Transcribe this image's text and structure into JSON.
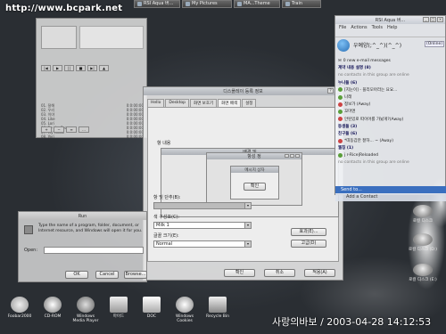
{
  "watermark": "http://www.bcpark.net",
  "taskbar": [
    {
      "label": "RSI Aqua 버..."
    },
    {
      "label": "My Pictures"
    },
    {
      "label": "MA...Theme"
    },
    {
      "label": "Train"
    }
  ],
  "player": {
    "playlist": [
      {
        "name": "01. 잘해",
        "time": "0:0:00:00"
      },
      {
        "name": "02. 우리",
        "time": "0:0:00:00"
      },
      {
        "name": "03. 이야",
        "time": "0:0:00:00"
      },
      {
        "name": "04. Like",
        "time": "0:0:00:00"
      },
      {
        "name": "05. Lori",
        "time": "0:0:00:00"
      },
      {
        "name": "06. By the Sea",
        "time": "0:0:00:00"
      },
      {
        "name": "07. My Music",
        "time": "0:0:00:00"
      },
      {
        "name": "08. Yeri",
        "time": "0:0:00:00"
      }
    ]
  },
  "display_props": {
    "title": "디스플레이 등록 정보",
    "tabs": [
      "Hello",
      "Desktop",
      "화면 보호기",
      "화면 배색",
      "설정"
    ],
    "inner_title": "배경 및",
    "inner_title2": "항성 정",
    "list_label": "항 내용",
    "msg_title": "메시지 상자",
    "ok_small": "확인",
    "item_label": "항 및 단추(B):",
    "scheme_label": "색 구성표(C):",
    "scheme_value": "Milk 1",
    "font_label": "글꼴 크기(E):",
    "font_value": "Normal",
    "effects_btn": "효과(E)...",
    "advanced_btn": "고급(D)",
    "ok": "확인",
    "cancel": "취소",
    "apply": "적용(A)"
  },
  "run": {
    "title": "Run",
    "desc": "Type the name of a program, folder, document, or Internet resource, and Windows will open it for you.",
    "open_label": "Open:",
    "ok": "OK",
    "cancel": "Cancel",
    "browse": "Browse..."
  },
  "msn": {
    "title": "RSI Aqua 버...",
    "menu": [
      "File",
      "Actions",
      "Tools",
      "Help"
    ],
    "nick": "우예양(;^_^)(^_^)",
    "status": "(Online)",
    "rows": [
      {
        "text": "0 new e-mail messages",
        "kind": "info"
      },
      {
        "text": "계약 내용 설명 (8)",
        "kind": "group"
      },
      {
        "text": "no contacts in this group are online",
        "kind": "dim"
      },
      {
        "text": "누나들 (6)",
        "kind": "group"
      },
      {
        "text": "[지눈이] - 플리모아라는 요요...",
        "kind": "on"
      },
      {
        "text": "나래",
        "kind": "on"
      },
      {
        "text": "정보가 (Away)",
        "kind": "on"
      },
      {
        "text": "꼬마엔",
        "kind": "on"
      },
      {
        "text": "안된있로 따이어를 가놨게?(Away)",
        "kind": "on"
      },
      {
        "text": "동생들 (3)",
        "kind": "group"
      },
      {
        "text": "친구들 (6)",
        "kind": "group"
      },
      {
        "text": "*띠동갑만 잘하... ~ (Away)",
        "kind": "on"
      },
      {
        "text": "웹칭 (1)",
        "kind": "group"
      },
      {
        "text": "j r-Rice|Reloaded",
        "kind": "on"
      },
      {
        "text": "no contacts in this group are online",
        "kind": "dim"
      }
    ],
    "selected": "Send to...",
    "add": "Add a Contact"
  },
  "desktop_icons": [
    {
      "label": "Foobar2000",
      "color": "#d8d8d8"
    },
    {
      "label": "CD-ROM",
      "color": "#b9b9b9"
    },
    {
      "label": "Windows Media Player",
      "color": "#a0a0a0"
    },
    {
      "label": "마이드",
      "color": "#c7c7c7"
    },
    {
      "label": "DOC",
      "color": "#e0e0e0"
    },
    {
      "label": "Windows Cookies",
      "color": "#bbbbbb"
    },
    {
      "label": "Recycle Bin",
      "color": "#d0d0d0"
    }
  ],
  "right_icons": [
    {
      "label": "로컬 디스크"
    },
    {
      "label": "로컬 디스크 (D:)"
    },
    {
      "label": "로컬 디스크 (E:)"
    }
  ],
  "caption": "사랑의바보 / 2003-04-28 14:12:53"
}
